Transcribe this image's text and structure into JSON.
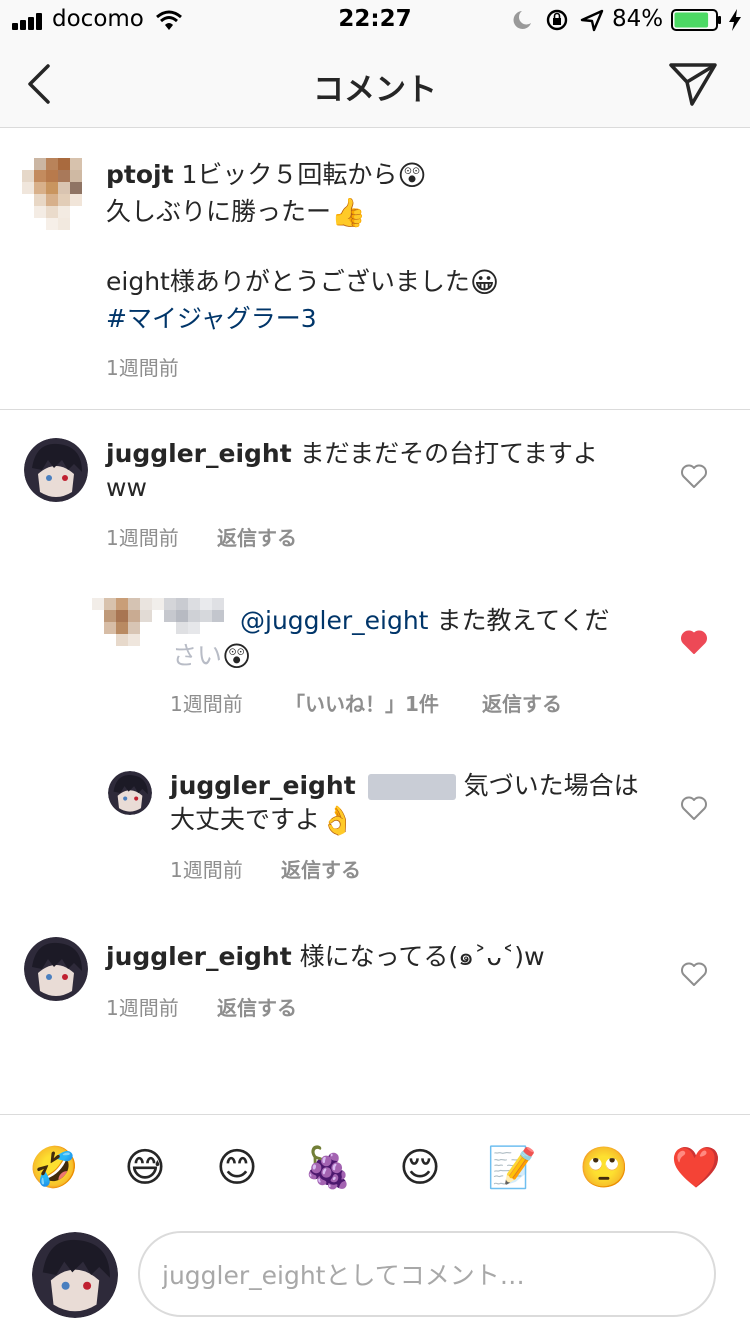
{
  "status_bar": {
    "carrier": "docomo",
    "time": "22:27",
    "battery_percent": "84%",
    "battery_level": 0.84,
    "battery_color": "#4cd964"
  },
  "nav": {
    "title": "コメント",
    "back_icon": "chevron-left-icon",
    "send_icon": "paper-plane-icon"
  },
  "caption": {
    "username": "ptojt",
    "line1": "1ビック５回転から",
    "line1_emoji": "😲",
    "line2": "久しぶりに勝ったー",
    "line2_emoji": "👍",
    "line3": "eight様ありがとうございました",
    "line3_emoji": "😀",
    "hashtag": "#マイジャグラー3",
    "time": "1週間前"
  },
  "comments": [
    {
      "username": "juggler_eight",
      "text_line1": "まだまだその台打てますよ",
      "text_line2": "ww",
      "time": "1週間前",
      "reply": "返信する",
      "liked": false
    },
    {
      "mention": "@juggler_eight",
      "text_line1": "また教えてくだ",
      "text_line2": "さい",
      "emoji": "😲",
      "time": "1週間前",
      "likes": "「いいね！」1件",
      "reply": "返信する",
      "liked": true
    },
    {
      "username": "juggler_eight",
      "text_line1": "気づいた場合は",
      "text_line2": "大丈夫ですよ",
      "emoji": "👌",
      "time": "1週間前",
      "reply": "返信する",
      "liked": false
    },
    {
      "username": "juggler_eight",
      "text_line1": "様になってる(๑˃ᴗ˂)w",
      "time": "1週間前",
      "reply": "返信する",
      "liked": false
    }
  ],
  "emoji_bar": [
    "🤣",
    "😅",
    "😊",
    "🍇",
    "😌",
    "📝",
    "🙄",
    "❤️"
  ],
  "input": {
    "placeholder": "juggler_eightとしてコメント…",
    "value": ""
  },
  "colors": {
    "link": "#003569",
    "meta": "#8e8e8e",
    "liked_heart": "#ed4956",
    "divider": "#dbdbdb"
  }
}
